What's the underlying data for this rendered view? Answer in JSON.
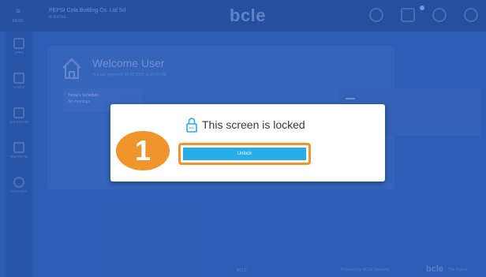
{
  "topbar": {
    "menu_label": "MENU",
    "company_name": "PEPSI Cola Bottling Co. Ltd Sd",
    "company_sub": "B-NHSH...",
    "logo": "bcle"
  },
  "sidebar": {
    "items": [
      {
        "label": "APPS"
      },
      {
        "label": "TASKS"
      },
      {
        "label": "CALENDAR"
      },
      {
        "label": "REPORTS"
      },
      {
        "label": "HISTORY"
      }
    ]
  },
  "main": {
    "welcome": "Welcome User",
    "welcome_sub": "You last logged in 30.08.2023 at 10:00 AM",
    "inner_card_line1": "Today's Schedule",
    "inner_card_line2": "No meetings"
  },
  "footer": {
    "left": "BCLE",
    "mid": "Powered by BCLE Systems",
    "logo": "bcle",
    "right": "The Future"
  },
  "modal": {
    "title": "This screen is locked",
    "unlock_label": "Unlock"
  },
  "annotation": {
    "step_number": "1",
    "color": "#f0952c"
  },
  "colors": {
    "app_bg": "#2f63b8",
    "button": "#27aee6"
  }
}
